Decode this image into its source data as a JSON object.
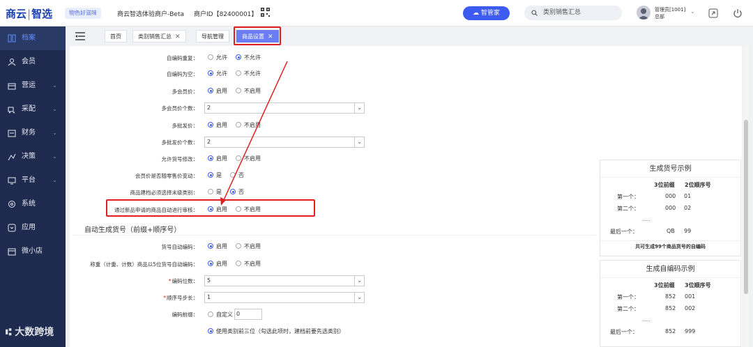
{
  "header": {
    "logo_main": "商云",
    "logo_sep": "|",
    "logo_sub": "智选",
    "slogan": "物色好滋味",
    "merchant": "商云智选体验商户-Beta",
    "merchant_id": "商户ID【82400001】",
    "assistant_button": "智管家",
    "search_placeholder": "类别销售汇总",
    "user_name": "管理员[1001]",
    "user_org": "总部"
  },
  "sidebar": {
    "items": [
      {
        "label": "档案",
        "icon": "archive-icon",
        "active": true
      },
      {
        "label": "会员",
        "icon": "member-icon"
      },
      {
        "label": "营运",
        "icon": "operations-icon"
      },
      {
        "label": "采配",
        "icon": "purchase-icon"
      },
      {
        "label": "财务",
        "icon": "finance-icon"
      },
      {
        "label": "决策",
        "icon": "decision-icon"
      },
      {
        "label": "平台",
        "icon": "platform-icon"
      },
      {
        "label": "系统",
        "icon": "system-icon"
      },
      {
        "label": "应用",
        "icon": "apps-icon"
      },
      {
        "label": "微小店",
        "icon": "store-icon"
      }
    ]
  },
  "tabs": [
    {
      "label": "首页"
    },
    {
      "label": "类别销售汇总"
    },
    {
      "label": "导航管理"
    },
    {
      "label": "商品设置",
      "active": true
    }
  ],
  "form": {
    "rows": [
      {
        "label": "自编码重复：",
        "opt1": "允许",
        "opt2": "不允许",
        "selected": 2
      },
      {
        "label": "自编码为空：",
        "opt1": "允许",
        "opt2": "不允许",
        "selected": 1
      },
      {
        "label": "多会员价：",
        "opt1": "启用",
        "opt2": "不启用",
        "selected": 1
      },
      {
        "label": "多会员价个数：",
        "value": "2"
      },
      {
        "label": "多批发价：",
        "opt1": "启用",
        "opt2": "不启用",
        "selected": 1
      },
      {
        "label": "多批发价个数：",
        "value": "2"
      },
      {
        "label": "允许货号修改：",
        "opt1": "启用",
        "opt2": "不启用",
        "selected": 1
      },
      {
        "label": "会员价是否随零售价变动：",
        "opt1": "是",
        "opt2": "否",
        "selected": 1
      },
      {
        "label": "商品建档必须选择末级类别：",
        "opt1": "是",
        "opt2": "否",
        "selected": 2
      },
      {
        "label": "通过新品申请的商品自动进行审核：",
        "opt1": "启用",
        "opt2": "不启用",
        "selected": 1
      }
    ],
    "section_title": "自动生成货号（前缀+顺序号）",
    "rows2": [
      {
        "label": "货号自动编码：",
        "opt1": "启用",
        "opt2": "不启用",
        "selected": 1
      },
      {
        "label": "称重（计重、计数）商品以5位货号自动编码：",
        "opt1": "启用",
        "opt2": "不启用",
        "selected": 1
      },
      {
        "label": "编码位数：",
        "value": "5",
        "required": true
      },
      {
        "label": "顺序号步长：",
        "value": "1",
        "required": true
      },
      {
        "label": "编码前缀：",
        "opt1": "自定义",
        "custom_value": "0"
      }
    ],
    "last_option": "使用类别前三位（勾选此项时，建档前要先选类别）"
  },
  "panel1": {
    "title": "生成货号示例",
    "col1": "3位前缀",
    "col2": "2位顺序号",
    "rows": [
      {
        "name": "第一个：",
        "a": "000",
        "b": "01"
      },
      {
        "name": "第二个：",
        "a": "000",
        "b": "02"
      },
      {
        "name": "......",
        "a": "",
        "b": ""
      },
      {
        "name": "最后一个：",
        "a": "QB",
        "b": "99"
      }
    ],
    "footer": "共可生成99个商品货号的自编码"
  },
  "panel2": {
    "title": "生成自编码示例",
    "col1": "3位前缀",
    "col2": "3位顺序号",
    "rows": [
      {
        "name": "第一个：",
        "a": "852",
        "b": "001"
      },
      {
        "name": "第二个：",
        "a": "852",
        "b": "002"
      },
      {
        "name": "......",
        "a": "",
        "b": ""
      },
      {
        "name": "最后一个：",
        "a": "852",
        "b": "999"
      }
    ]
  },
  "watermark": "大数跨境",
  "colors": {
    "accent": "#3d5af1",
    "sidebar": "#1e2a4e",
    "highlight": "#e02020"
  }
}
